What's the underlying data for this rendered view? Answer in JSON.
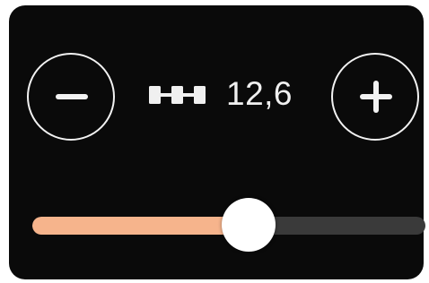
{
  "stitch_control": {
    "value_text": "12,6",
    "icon": "stitch-width-icon",
    "decrease_icon": "minus-icon",
    "increase_icon": "plus-icon"
  },
  "slider": {
    "level": 0.55
  },
  "colors": {
    "panel_background": "#0a0a0a",
    "slider_fill": "#f6b48c",
    "slider_track": "#3a3a3a",
    "foreground": "#f0f0f0"
  }
}
